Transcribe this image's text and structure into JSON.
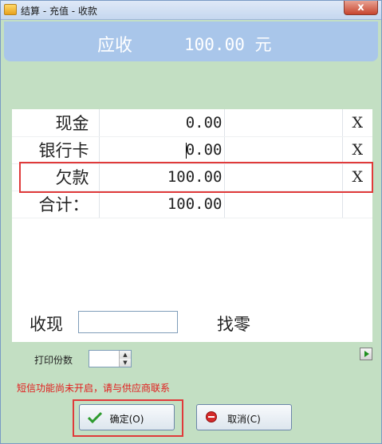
{
  "window": {
    "title": "结算 - 充值 - 收款",
    "close_label": "x"
  },
  "due": {
    "label": "应收",
    "amount": "100.00 元"
  },
  "payments": [
    {
      "name": "现金",
      "amount": "0.00",
      "clear": "X"
    },
    {
      "name": "银行卡",
      "amount": "0.00",
      "clear": "X"
    },
    {
      "name": "欠款",
      "amount": "100.00",
      "clear": "X"
    },
    {
      "name": "合计：",
      "amount": "100.00",
      "clear": ""
    }
  ],
  "received": {
    "label": "收现",
    "value": "",
    "change_label": "找零"
  },
  "print": {
    "label": "打印份数",
    "copies": ""
  },
  "notice": "短信功能尚未开启，请与供应商联系",
  "buttons": {
    "confirm": "确定(O)",
    "cancel": "取消(C)"
  },
  "colors": {
    "background": "#c3dfc3",
    "header": "#a9c6ea",
    "highlight": "#e03a3a",
    "notice": "#e21b1b"
  },
  "icons": {
    "confirm": "check-icon",
    "cancel": "no-entry-icon",
    "side": "play-arrow-icon",
    "app": "app-icon"
  }
}
